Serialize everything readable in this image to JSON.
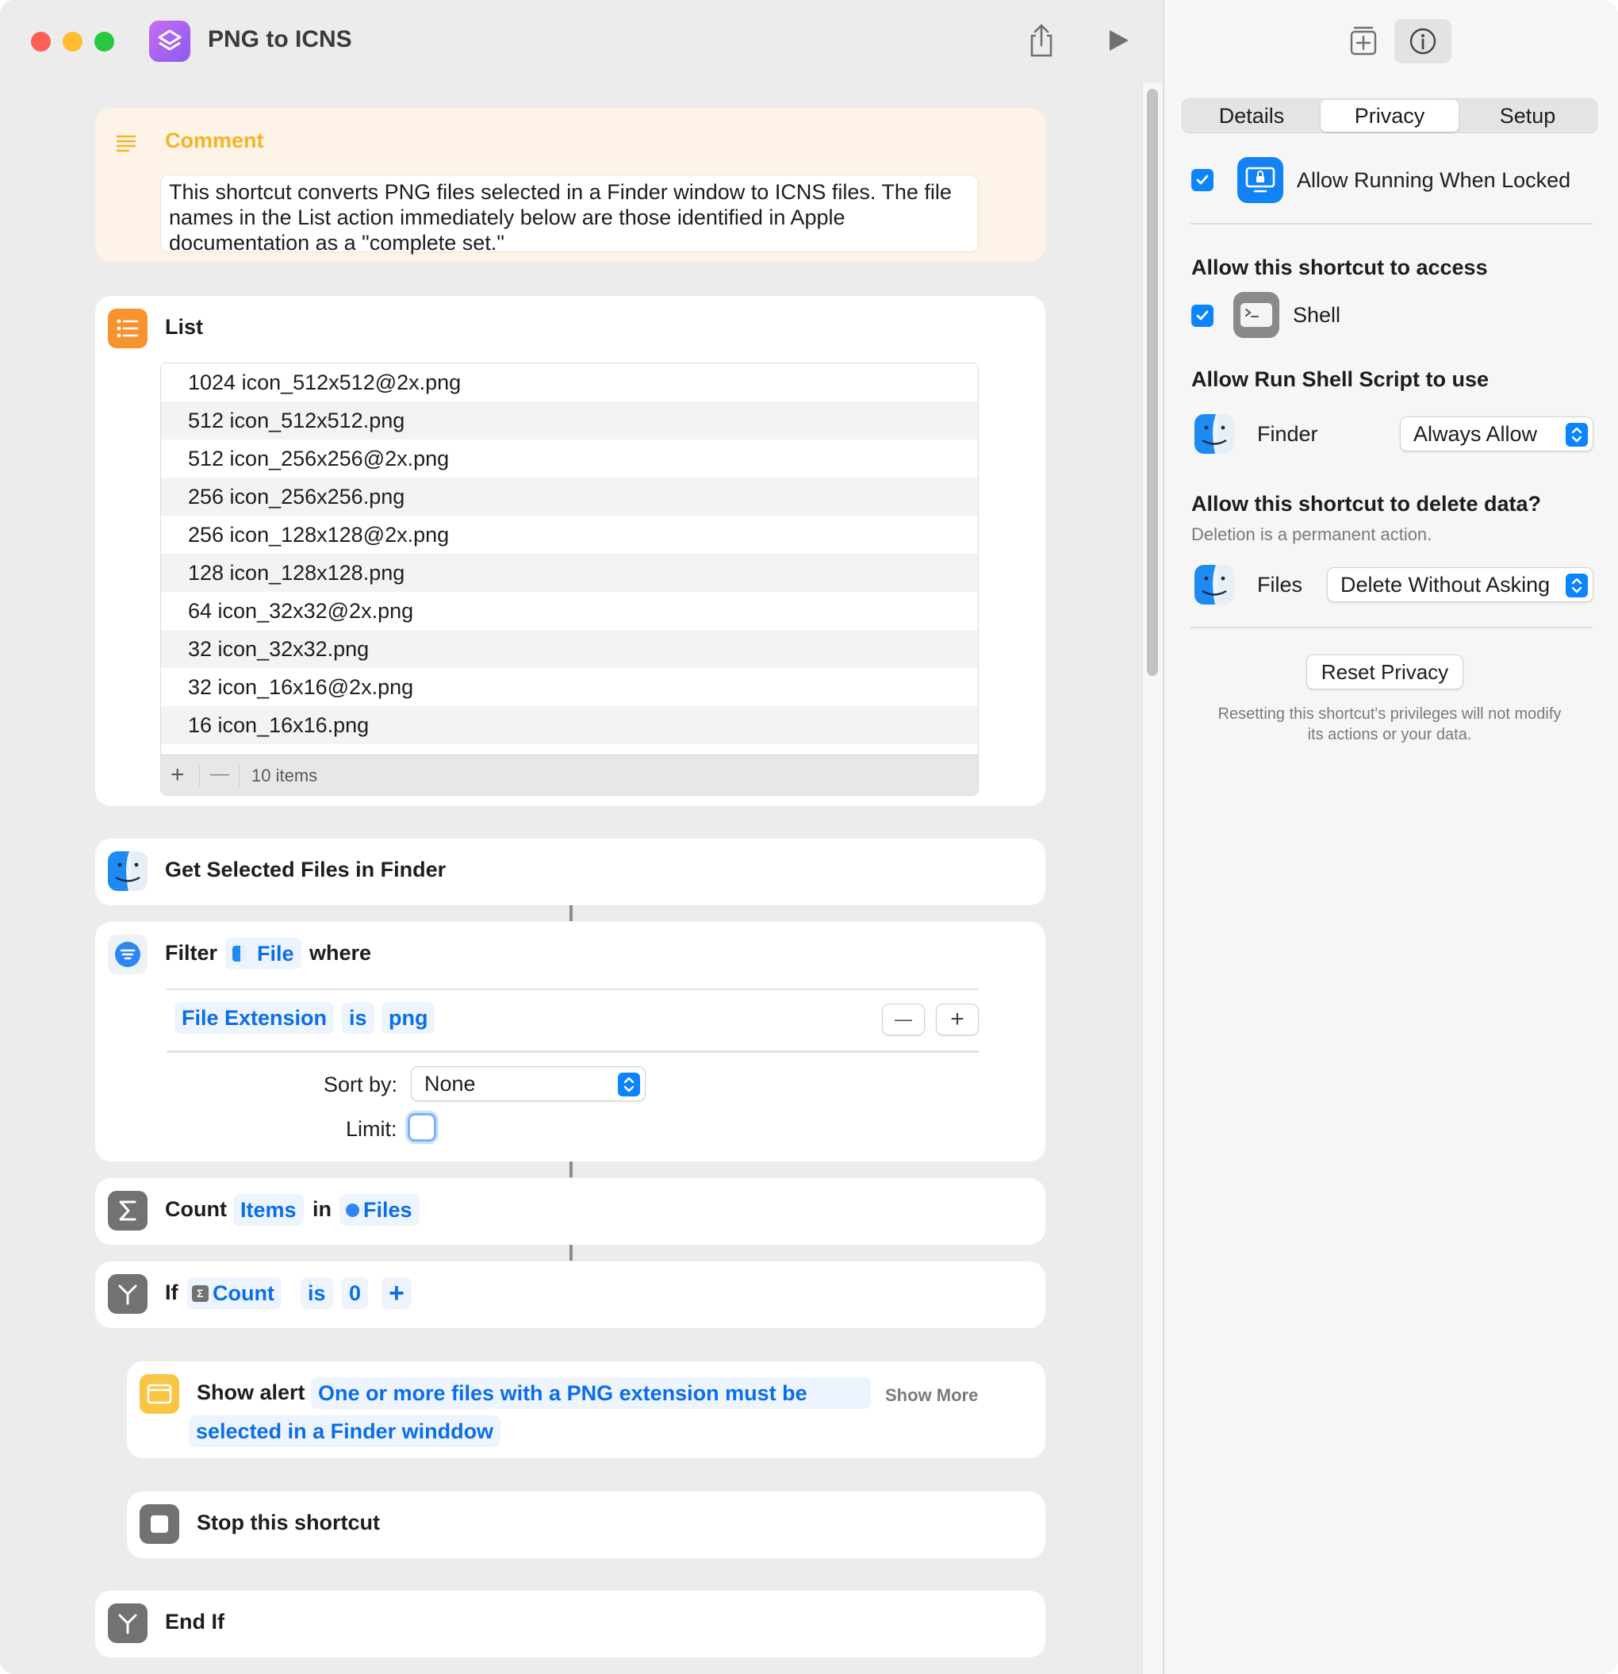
{
  "window": {
    "title": "PNG to ICNS"
  },
  "toolbar": {
    "share_icon": "share-icon",
    "run_icon": "play-icon",
    "library_icon": "add-to-library-icon",
    "info_icon": "info-icon"
  },
  "comment": {
    "title": "Comment",
    "text": "This shortcut converts PNG files selected in a Finder window to ICNS files. The file names in the List action immediately below are those identified in Apple documentation as a \"complete set.\""
  },
  "list": {
    "title": "List",
    "items": [
      "1024 icon_512x512@2x.png",
      "512 icon_512x512.png",
      "512 icon_256x256@2x.png",
      "256 icon_256x256.png",
      "256 icon_128x128@2x.png",
      "128 icon_128x128.png",
      "64 icon_32x32@2x.png",
      "32 icon_32x32.png",
      "32 icon_16x16@2x.png",
      "16 icon_16x16.png"
    ],
    "add": "+",
    "remove": "—",
    "count_label": "10 items"
  },
  "get_selected": {
    "title": "Get Selected Files in Finder"
  },
  "filter": {
    "title": "Filter",
    "input": "File",
    "where": "where",
    "condition": {
      "field": "File Extension",
      "op": "is",
      "value": "png"
    },
    "remove_btn": "—",
    "add_btn": "+",
    "sort_label": "Sort by:",
    "sort_value": "None",
    "limit_label": "Limit:"
  },
  "count": {
    "title": "Count",
    "what": "Items",
    "in": "in",
    "source": "Files"
  },
  "if_action": {
    "title": "If",
    "var": "Count",
    "op": "is",
    "value": "0",
    "add": "+"
  },
  "alert": {
    "title": "Show alert",
    "message_line1": "One or more files with a PNG extension must be",
    "message_line2": "selected in a Finder winddow",
    "show_more": "Show More"
  },
  "stop": {
    "title": "Stop this shortcut"
  },
  "endif": {
    "title": "End If"
  },
  "inspector": {
    "tabs": [
      "Details",
      "Privacy",
      "Setup"
    ],
    "active_tab": "Privacy",
    "allow_locked": {
      "label": "Allow Running When Locked",
      "checked": true
    },
    "access_heading": "Allow this shortcut to access",
    "access_items": [
      {
        "label": "Shell",
        "checked": true
      }
    ],
    "shell_heading": "Allow Run Shell Script to use",
    "shell_row": {
      "app": "Finder",
      "value": "Always Allow"
    },
    "delete_heading": "Allow this shortcut to delete data?",
    "delete_sub": "Deletion is a permanent action.",
    "delete_row": {
      "app": "Files",
      "value": "Delete Without Asking"
    },
    "reset_button": "Reset Privacy",
    "reset_note_line1": "Resetting this shortcut's privileges will not modify",
    "reset_note_line2": "its actions or your data."
  },
  "colors": {
    "accent": "#0a84ff",
    "token_text": "#0a6ee8",
    "comment_bg": "#fdf3e6",
    "comment_title": "#f5b326",
    "list_icon": "#f7922e",
    "alert_icon": "#f8c545",
    "filter_icon": "#2c87f2",
    "gray_icon": "#727272"
  }
}
